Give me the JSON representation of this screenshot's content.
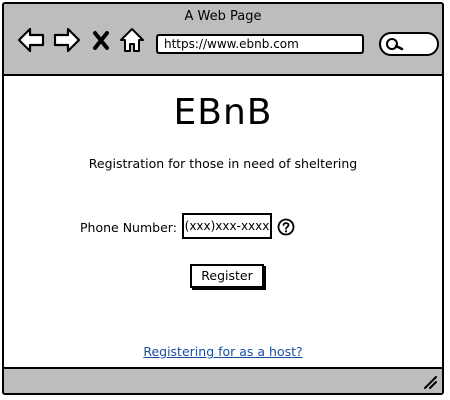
{
  "window": {
    "title": "A Web Page"
  },
  "toolbar": {
    "icons": [
      "back-arrow-icon",
      "forward-arrow-icon",
      "close-icon",
      "home-icon",
      "search-icon"
    ],
    "url": "https://www.ebnb.com"
  },
  "main": {
    "brand": "EBnB",
    "subtitle": "Registration for those in need of sheltering",
    "phone_label": "Phone Number:",
    "phone_placeholder": "(xxx)xxx-xxxx",
    "help_icon": "question-circle-icon",
    "register_label": "Register",
    "host_link": "Registering for as a host?"
  },
  "colors": {
    "chrome": "#bdbdbd",
    "link": "#1a4fa0"
  }
}
